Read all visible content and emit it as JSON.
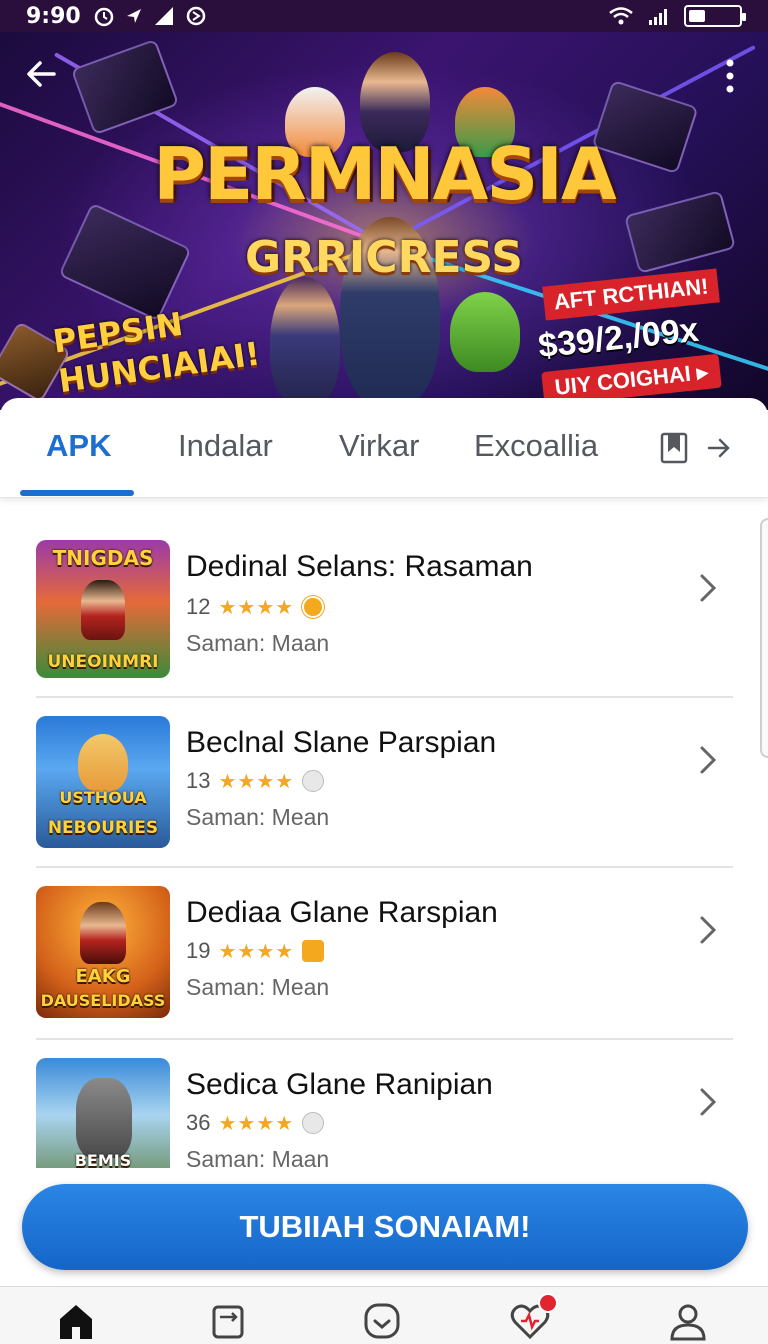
{
  "status_bar": {
    "time": "9:90",
    "battery_level": 0.3
  },
  "hero": {
    "title": "PERMNASIA",
    "subtitle": "GRRICRESS",
    "left_text": "PEPSIN HUNCIAIAI!",
    "right_label": "AFT RCTHIAN!",
    "right_price": "$39/2,/09x",
    "right_cta": "UIY COIGHAI ▸",
    "back_icon": "arrow-left-icon",
    "menu_icon": "more-vertical-icon"
  },
  "tabs": [
    {
      "label": "APK",
      "active": true
    },
    {
      "label": "Indalar",
      "active": false
    },
    {
      "label": "Virkar",
      "active": false
    },
    {
      "label": "Excoallia",
      "active": false
    }
  ],
  "tab_icons": [
    "bookmark-icon",
    "arrow-right-icon"
  ],
  "apps": [
    {
      "title": "Dedinal Selans: Rasaman",
      "rating_count": "12",
      "stars": "★★★★",
      "meta": "Saman: Maan",
      "thumb_top_text": "TNIGDAS",
      "thumb_bottom_text": "UNEOINMRI",
      "badge_color": "#f3a81d"
    },
    {
      "title": "Beclnal Slane Parspian",
      "rating_count": "13",
      "stars": "★★★★",
      "meta": "Saman: Mean",
      "thumb_top_text": "USTHOUA",
      "thumb_bottom_text": "NEBOURIES",
      "badge_color": "#d6d6d6"
    },
    {
      "title": "Dediaa Glane Rarspian",
      "rating_count": "19",
      "stars": "★★★★",
      "meta": "Saman: Mean",
      "thumb_top_text": "EAKG",
      "thumb_bottom_text": "DAUSELIDASS",
      "badge_color": "#f3a81d"
    },
    {
      "title": "Sedica Glane Ranipian",
      "rating_count": "36",
      "stars": "★★★★",
      "meta": "Saman: Maan",
      "thumb_top_text": "",
      "thumb_bottom_text": "BEMIS",
      "badge_color": "#d6d6d6"
    }
  ],
  "cta_label": "TUBIIAH SONAIAM!",
  "bottom_nav": [
    {
      "icon": "home-icon",
      "active": true
    },
    {
      "icon": "repeat-icon",
      "active": false
    },
    {
      "icon": "chat-icon",
      "active": false
    },
    {
      "icon": "heart-icon",
      "active": false,
      "badge": true
    },
    {
      "icon": "user-icon",
      "active": false
    }
  ],
  "colors": {
    "accent": "#1c6fd0",
    "star": "#f3a81d",
    "hero_title": "#ffc83a",
    "promo_red": "#d8232a"
  }
}
